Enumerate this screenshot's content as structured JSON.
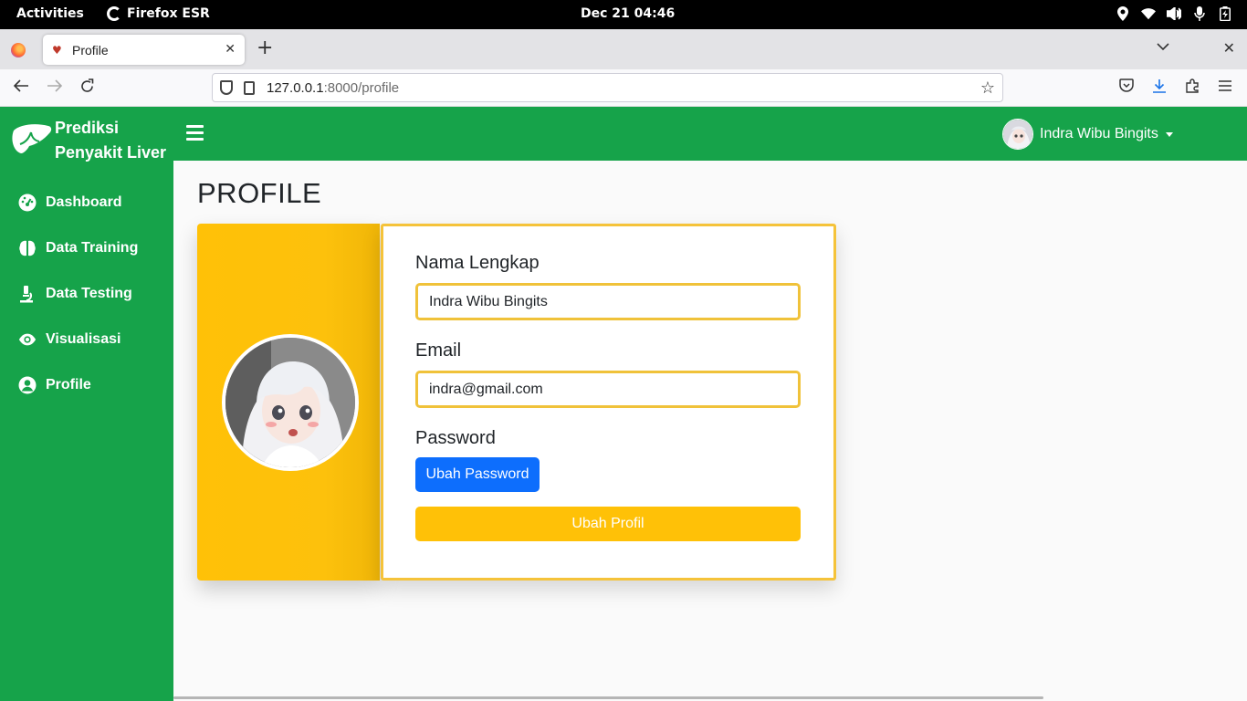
{
  "system": {
    "activities": "Activities",
    "app": "Firefox ESR",
    "clock": "Dec 21  04:46"
  },
  "browser": {
    "tab_title": "Profile",
    "url_host": "127.0.0.1",
    "url_path": ":8000/profile"
  },
  "sidebar": {
    "brand_line1": "Prediksi",
    "brand_line2": "Penyakit Liver",
    "items": [
      {
        "label": "Dashboard",
        "icon": "gauge-icon"
      },
      {
        "label": "Data Training",
        "icon": "brain-icon"
      },
      {
        "label": "Data Testing",
        "icon": "microscope-icon"
      },
      {
        "label": "Visualisasi",
        "icon": "eye-icon"
      },
      {
        "label": "Profile",
        "icon": "user-circle-icon"
      }
    ]
  },
  "header": {
    "user_name": "Indra Wibu Bingits"
  },
  "main": {
    "title": "PROFILE",
    "name_label": "Nama Lengkap",
    "name_value": "Indra Wibu Bingits",
    "email_label": "Email",
    "email_value": "indra@gmail.com",
    "password_label": "Password",
    "change_password_button": "Ubah Password",
    "update_profile_button": "Ubah Profil"
  },
  "colors": {
    "sidebar_green": "#16a34a",
    "accent_yellow": "#ffc107",
    "primary_blue": "#0d6efd"
  }
}
